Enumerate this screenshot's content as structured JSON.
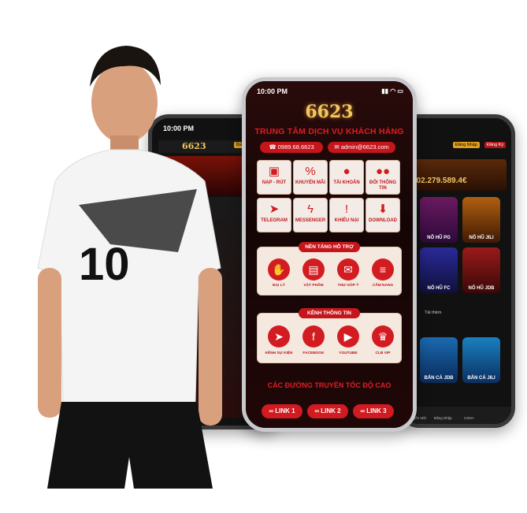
{
  "main_phone": {
    "time": "10:00 PM",
    "logo": "6623",
    "header_title": "TRUNG TÂM DỊCH VỤ KHÁCH HÀNG",
    "phone": "0989.68.6623",
    "email": "admin@6623.com",
    "tiles": [
      {
        "icon": "bank-icon",
        "label": "NẠP - RÚT"
      },
      {
        "icon": "percent-icon",
        "label": "KHUYẾN MÃI"
      },
      {
        "icon": "user-icon",
        "label": "TÀI KHOẢN"
      },
      {
        "icon": "users-icon",
        "label": "ĐỔI THÔNG TIN"
      },
      {
        "icon": "telegram-icon",
        "label": "TELEGRAM"
      },
      {
        "icon": "messenger-icon",
        "label": "MESSENGER"
      },
      {
        "icon": "alert-icon",
        "label": "KHIẾU NẠI"
      },
      {
        "icon": "download-icon",
        "label": "DOWNLOAD"
      }
    ],
    "support": {
      "title": "NỀN TẢNG HỖ TRỢ",
      "items": [
        "ĐẠI LÝ",
        "VẬT PHẨM",
        "THƯ GÓP Ý",
        "CẨM NANG"
      ]
    },
    "channels": {
      "title": "KÊNH THÔNG TIN",
      "items": [
        "KÊNH SỰ KIỆN",
        "FACEBOOK",
        "YOUTUBE",
        "CLB VIP"
      ]
    },
    "links_title": "CÁC ĐƯỜNG TRUYỀN TỐC ĐỘ CAO",
    "links": [
      "LINK 1",
      "LINK 2",
      "LINK 3"
    ]
  },
  "left_phone": {
    "time": "10:00 PM",
    "logo": "6623",
    "button": "Đăng Nhập"
  },
  "right_phone": {
    "login": "Đăng Nhập",
    "register": "Đăng Ký",
    "jackpot": "902.279.589.4€",
    "games": [
      "NỔ HŨ PG",
      "NỔ HŨ JILI",
      "NỔ HŨ FC",
      "NỔ HŨ JDB",
      "BẮN CÁ JDB",
      "BẮN CÁ JILI"
    ],
    "note": "Tải thêm",
    "nav": [
      "Khuyến Mãi",
      "Đăng Nhập",
      "CSKH"
    ]
  },
  "jersey_number": "10",
  "colors": {
    "brand_red": "#d31c22",
    "gold": "#f3c660",
    "panel": "#f5e9df"
  }
}
